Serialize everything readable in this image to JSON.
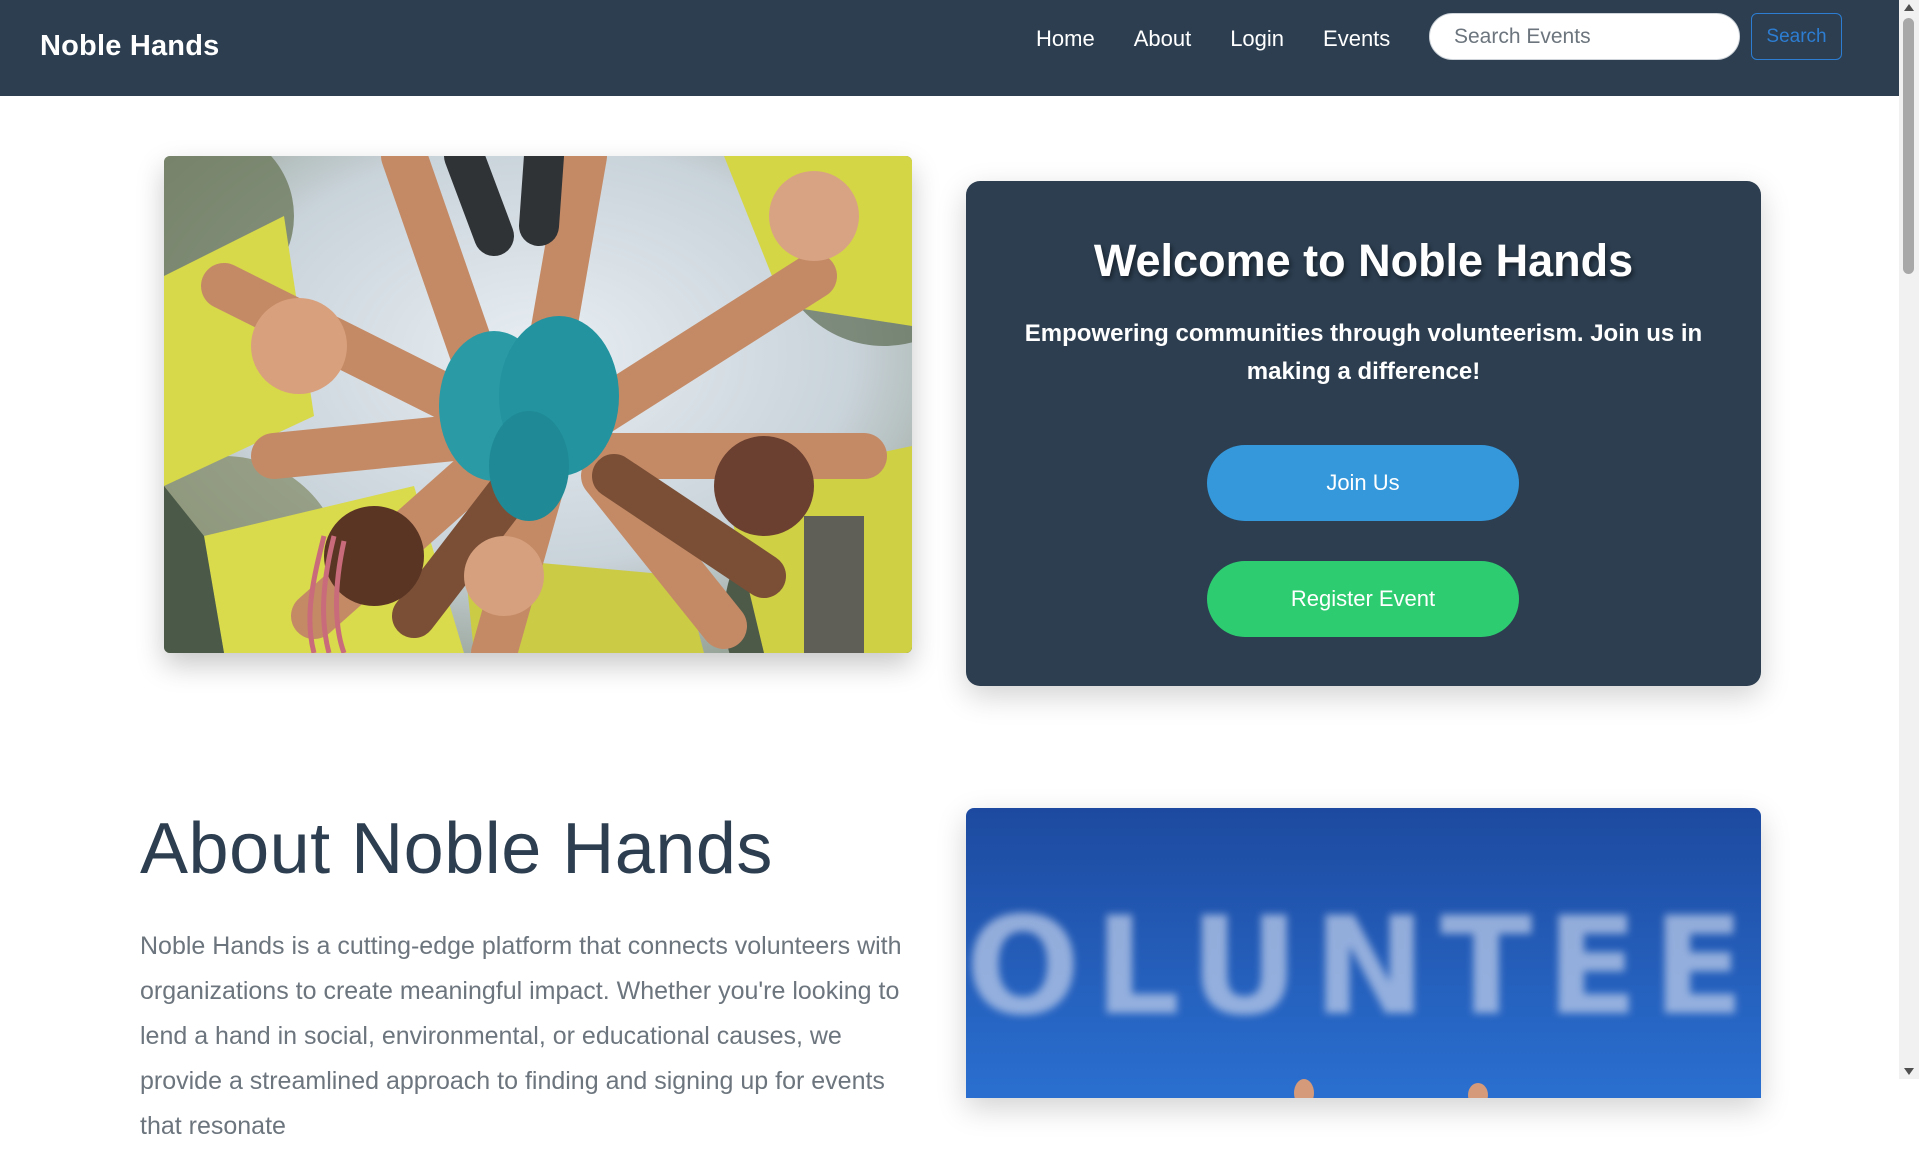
{
  "header": {
    "brand": "Noble Hands",
    "nav": [
      "Home",
      "About",
      "Login",
      "Events"
    ],
    "search_placeholder": "Search Events",
    "search_button": "Search"
  },
  "hero": {
    "image_alt": "Volunteers joining hands in a circle",
    "card": {
      "title": "Welcome to Noble Hands",
      "subtitle": "Empowering communities through volunteerism. Join us in making a difference!",
      "join_button": "Join Us",
      "register_button": "Register Event"
    }
  },
  "about": {
    "title": "About Noble Hands",
    "text": "Noble Hands is a cutting-edge platform that connects volunteers with organizations to create meaningful impact. Whether you're looking to lend a hand in social, environmental, or educational causes, we provide a streamlined approach to finding and signing up for events that resonate",
    "image_word": "VOLUNTEER"
  },
  "colors": {
    "navbar": "#2c3e50",
    "join": "#3498db",
    "register": "#2ecc71",
    "search_accent": "#2d7dd2"
  }
}
